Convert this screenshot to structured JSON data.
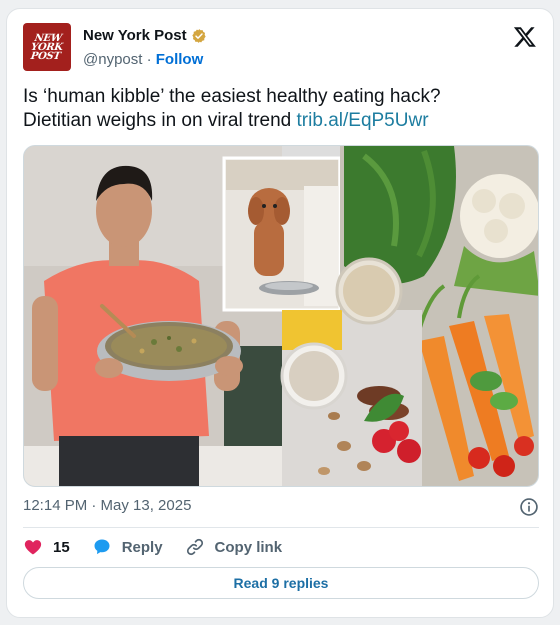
{
  "account": {
    "logo_text": "NEW YORK POST",
    "display_name": "New York Post",
    "handle": "@nypost",
    "separator": "·",
    "follow_label": "Follow"
  },
  "tweet": {
    "text_line1": "Is ‘human kibble’ the easiest healthy eating hack?",
    "text_line2": "Dietitian weighs in on viral trend ",
    "link": "trib.al/EqP5Uwr"
  },
  "meta": {
    "timestamp": "12:14 PM · May 13, 2025"
  },
  "actions": {
    "like_count": "15",
    "reply_label": "Reply",
    "copy_label": "Copy link"
  },
  "replies_button": "Read 9 replies",
  "colors": {
    "brand_red": "#a3201d",
    "link": "#1d7da0",
    "like_pink": "#f91880",
    "reply_blue": "#1d9bf0"
  }
}
